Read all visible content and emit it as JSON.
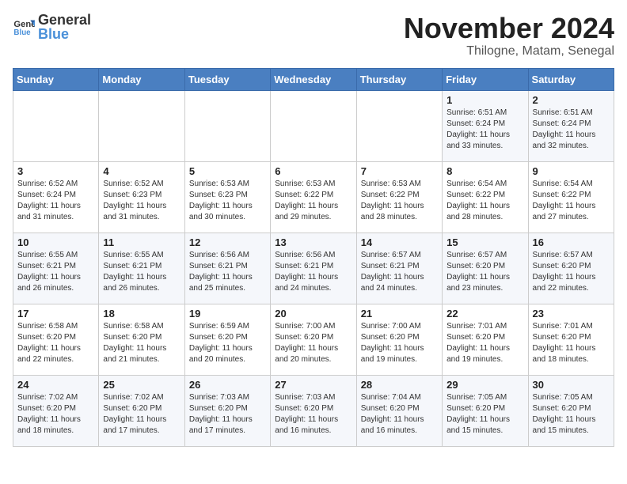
{
  "logo": {
    "text_general": "General",
    "text_blue": "Blue"
  },
  "title": {
    "month": "November 2024",
    "location": "Thilogne, Matam, Senegal"
  },
  "headers": [
    "Sunday",
    "Monday",
    "Tuesday",
    "Wednesday",
    "Thursday",
    "Friday",
    "Saturday"
  ],
  "weeks": [
    [
      {
        "day": "",
        "info": ""
      },
      {
        "day": "",
        "info": ""
      },
      {
        "day": "",
        "info": ""
      },
      {
        "day": "",
        "info": ""
      },
      {
        "day": "",
        "info": ""
      },
      {
        "day": "1",
        "info": "Sunrise: 6:51 AM\nSunset: 6:24 PM\nDaylight: 11 hours\nand 33 minutes."
      },
      {
        "day": "2",
        "info": "Sunrise: 6:51 AM\nSunset: 6:24 PM\nDaylight: 11 hours\nand 32 minutes."
      }
    ],
    [
      {
        "day": "3",
        "info": "Sunrise: 6:52 AM\nSunset: 6:24 PM\nDaylight: 11 hours\nand 31 minutes."
      },
      {
        "day": "4",
        "info": "Sunrise: 6:52 AM\nSunset: 6:23 PM\nDaylight: 11 hours\nand 31 minutes."
      },
      {
        "day": "5",
        "info": "Sunrise: 6:53 AM\nSunset: 6:23 PM\nDaylight: 11 hours\nand 30 minutes."
      },
      {
        "day": "6",
        "info": "Sunrise: 6:53 AM\nSunset: 6:22 PM\nDaylight: 11 hours\nand 29 minutes."
      },
      {
        "day": "7",
        "info": "Sunrise: 6:53 AM\nSunset: 6:22 PM\nDaylight: 11 hours\nand 28 minutes."
      },
      {
        "day": "8",
        "info": "Sunrise: 6:54 AM\nSunset: 6:22 PM\nDaylight: 11 hours\nand 28 minutes."
      },
      {
        "day": "9",
        "info": "Sunrise: 6:54 AM\nSunset: 6:22 PM\nDaylight: 11 hours\nand 27 minutes."
      }
    ],
    [
      {
        "day": "10",
        "info": "Sunrise: 6:55 AM\nSunset: 6:21 PM\nDaylight: 11 hours\nand 26 minutes."
      },
      {
        "day": "11",
        "info": "Sunrise: 6:55 AM\nSunset: 6:21 PM\nDaylight: 11 hours\nand 26 minutes."
      },
      {
        "day": "12",
        "info": "Sunrise: 6:56 AM\nSunset: 6:21 PM\nDaylight: 11 hours\nand 25 minutes."
      },
      {
        "day": "13",
        "info": "Sunrise: 6:56 AM\nSunset: 6:21 PM\nDaylight: 11 hours\nand 24 minutes."
      },
      {
        "day": "14",
        "info": "Sunrise: 6:57 AM\nSunset: 6:21 PM\nDaylight: 11 hours\nand 24 minutes."
      },
      {
        "day": "15",
        "info": "Sunrise: 6:57 AM\nSunset: 6:20 PM\nDaylight: 11 hours\nand 23 minutes."
      },
      {
        "day": "16",
        "info": "Sunrise: 6:57 AM\nSunset: 6:20 PM\nDaylight: 11 hours\nand 22 minutes."
      }
    ],
    [
      {
        "day": "17",
        "info": "Sunrise: 6:58 AM\nSunset: 6:20 PM\nDaylight: 11 hours\nand 22 minutes."
      },
      {
        "day": "18",
        "info": "Sunrise: 6:58 AM\nSunset: 6:20 PM\nDaylight: 11 hours\nand 21 minutes."
      },
      {
        "day": "19",
        "info": "Sunrise: 6:59 AM\nSunset: 6:20 PM\nDaylight: 11 hours\nand 20 minutes."
      },
      {
        "day": "20",
        "info": "Sunrise: 7:00 AM\nSunset: 6:20 PM\nDaylight: 11 hours\nand 20 minutes."
      },
      {
        "day": "21",
        "info": "Sunrise: 7:00 AM\nSunset: 6:20 PM\nDaylight: 11 hours\nand 19 minutes."
      },
      {
        "day": "22",
        "info": "Sunrise: 7:01 AM\nSunset: 6:20 PM\nDaylight: 11 hours\nand 19 minutes."
      },
      {
        "day": "23",
        "info": "Sunrise: 7:01 AM\nSunset: 6:20 PM\nDaylight: 11 hours\nand 18 minutes."
      }
    ],
    [
      {
        "day": "24",
        "info": "Sunrise: 7:02 AM\nSunset: 6:20 PM\nDaylight: 11 hours\nand 18 minutes."
      },
      {
        "day": "25",
        "info": "Sunrise: 7:02 AM\nSunset: 6:20 PM\nDaylight: 11 hours\nand 17 minutes."
      },
      {
        "day": "26",
        "info": "Sunrise: 7:03 AM\nSunset: 6:20 PM\nDaylight: 11 hours\nand 17 minutes."
      },
      {
        "day": "27",
        "info": "Sunrise: 7:03 AM\nSunset: 6:20 PM\nDaylight: 11 hours\nand 16 minutes."
      },
      {
        "day": "28",
        "info": "Sunrise: 7:04 AM\nSunset: 6:20 PM\nDaylight: 11 hours\nand 16 minutes."
      },
      {
        "day": "29",
        "info": "Sunrise: 7:05 AM\nSunset: 6:20 PM\nDaylight: 11 hours\nand 15 minutes."
      },
      {
        "day": "30",
        "info": "Sunrise: 7:05 AM\nSunset: 6:20 PM\nDaylight: 11 hours\nand 15 minutes."
      }
    ]
  ]
}
